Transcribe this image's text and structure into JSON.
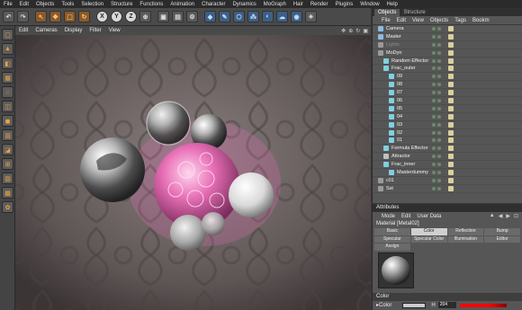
{
  "menubar": [
    "File",
    "Edit",
    "Objects",
    "Tools",
    "Selection",
    "Structure",
    "Functions",
    "Animation",
    "Character",
    "Dynamics",
    "MoGraph",
    "Hair",
    "Render",
    "Plugins",
    "Window",
    "Help"
  ],
  "toolbar": {
    "axis_buttons": [
      "X",
      "Y",
      "Z"
    ]
  },
  "viewport": {
    "menu": [
      "Edit",
      "Cameras",
      "Display",
      "Filter",
      "View"
    ]
  },
  "objects_panel": {
    "tabs": [
      "Objects",
      "Structure"
    ],
    "menu": [
      "File",
      "Edit",
      "View",
      "Objects",
      "Tags",
      "Bookm"
    ],
    "items": [
      {
        "label": "Camera",
        "indent": 0,
        "color": "#8fb7e6"
      },
      {
        "label": "Master",
        "indent": 0,
        "color": "#8fb7e6"
      },
      {
        "label": "Lights",
        "indent": 0,
        "color": "#999999",
        "dim": true
      },
      {
        "label": "MoDyn",
        "indent": 0,
        "color": "#9a9a9a"
      },
      {
        "label": "Random Effector",
        "indent": 1,
        "color": "#7fd0e0"
      },
      {
        "label": "Frac_outer",
        "indent": 1,
        "color": "#7fd0e0"
      },
      {
        "label": "09",
        "indent": 2,
        "color": "#7fd0e0"
      },
      {
        "label": "08",
        "indent": 2,
        "color": "#7fd0e0"
      },
      {
        "label": "07",
        "indent": 2,
        "color": "#7fd0e0"
      },
      {
        "label": "06",
        "indent": 2,
        "color": "#7fd0e0"
      },
      {
        "label": "05",
        "indent": 2,
        "color": "#7fd0e0"
      },
      {
        "label": "04",
        "indent": 2,
        "color": "#7fd0e0"
      },
      {
        "label": "03",
        "indent": 2,
        "color": "#7fd0e0"
      },
      {
        "label": "02",
        "indent": 2,
        "color": "#7fd0e0"
      },
      {
        "label": "01",
        "indent": 2,
        "color": "#7fd0e0"
      },
      {
        "label": "Formula Effector",
        "indent": 1,
        "color": "#7fd0e0"
      },
      {
        "label": "Attractor",
        "indent": 1,
        "color": "#c0c0c0"
      },
      {
        "label": "Frac_inner",
        "indent": 1,
        "color": "#7fd0e0"
      },
      {
        "label": "Masterdummy",
        "indent": 2,
        "color": "#7fd0e0"
      },
      {
        "label": "c01",
        "indent": 0,
        "color": "#9a9a9a"
      },
      {
        "label": "Sst",
        "indent": 0,
        "color": "#9a9a9a"
      }
    ]
  },
  "attributes": {
    "title": "Attributes",
    "menu": [
      "Mode",
      "Edit",
      "User Data"
    ],
    "material_name": "Material [Metal02]",
    "tabs": [
      "Basic",
      "Color",
      "Reflection",
      "Bump",
      "Specular",
      "Specular Color",
      "Illumination",
      "Editor",
      "Assign"
    ],
    "active_tab": "Color",
    "color_section": "Color",
    "color_label": "Color",
    "h_label": "H",
    "h_value": "204"
  },
  "colors": {
    "pink_glow": "#e86fb6",
    "panel_bg": "#565656",
    "menubar_bg": "#2b2b2b"
  }
}
